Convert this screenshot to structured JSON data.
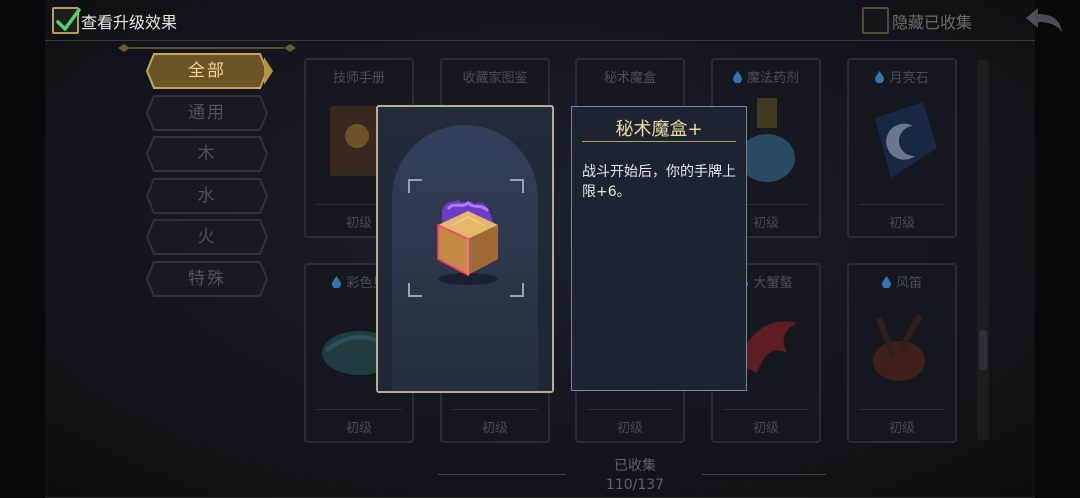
{
  "topbar": {
    "show_upgrade_label": "查看升级效果",
    "show_upgrade_checked": true,
    "hide_collected_label": "隐藏已收集",
    "hide_collected_checked": false
  },
  "categories": [
    {
      "label": "全部",
      "active": true
    },
    {
      "label": "通用",
      "active": false
    },
    {
      "label": "木",
      "active": false
    },
    {
      "label": "水",
      "active": false
    },
    {
      "label": "火",
      "active": false
    },
    {
      "label": "特殊",
      "active": false
    }
  ],
  "cards": [
    {
      "title": "技师手册",
      "level": "初级",
      "element": "none",
      "icon": "book-icon"
    },
    {
      "title": "收藏家图鉴",
      "level": "",
      "element": "none",
      "icon": "none"
    },
    {
      "title": "秘术魔盒",
      "level": "",
      "element": "none",
      "icon": "none"
    },
    {
      "title": "魔法药剂",
      "level": "初级",
      "element": "water",
      "icon": "potion-icon"
    },
    {
      "title": "月亮石",
      "level": "初级",
      "element": "water",
      "icon": "moonstone-icon"
    },
    {
      "title": "彩色贝",
      "level": "初级",
      "element": "water",
      "icon": "shell-icon"
    },
    {
      "title": "",
      "level": "初级",
      "element": "none",
      "icon": "none"
    },
    {
      "title": "",
      "level": "初级",
      "element": "none",
      "icon": "none"
    },
    {
      "title": "大蟹螯",
      "level": "初级",
      "element": "water",
      "icon": "crab-claw-icon"
    },
    {
      "title": "风笛",
      "level": "初级",
      "element": "water",
      "icon": "bagpipe-icon"
    }
  ],
  "collection": {
    "label": "已收集",
    "count": "110/137"
  },
  "detail": {
    "title": "秘术魔盒+",
    "description": "战斗开始后，你的手牌上限+6。",
    "icon": "mystic-box-icon"
  },
  "colors": {
    "accent_gold": "#f0d79a",
    "check_green": "#4fd36a",
    "water_blue": "#3a7ec4"
  }
}
